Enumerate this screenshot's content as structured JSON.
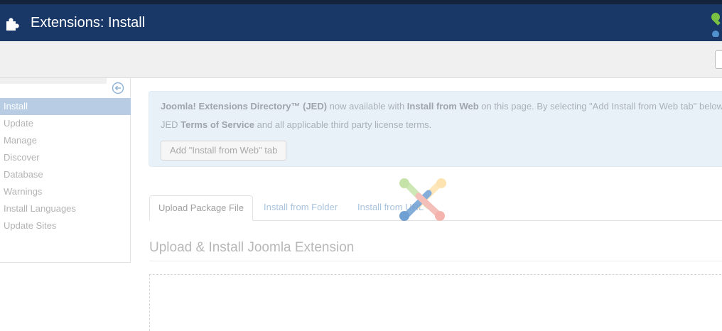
{
  "header": {
    "title": "Extensions: Install",
    "icon": "puzzle-icon",
    "bg_color": "#1a3867"
  },
  "sidebar": {
    "toggle_icon": "collapse-left-icon",
    "items": [
      {
        "label": "Install",
        "active": true
      },
      {
        "label": "Update"
      },
      {
        "label": "Manage"
      },
      {
        "label": "Discover"
      },
      {
        "label": "Database"
      },
      {
        "label": "Warnings"
      },
      {
        "label": "Install Languages"
      },
      {
        "label": "Update Sites"
      }
    ]
  },
  "notice": {
    "jed_name": "Joomla! Extensions Directory™ (JED)",
    "text1": " now available with ",
    "install_from_web": "Install from Web",
    "text2": " on this page. By selecting \"Add Install from Web tab\" below",
    "jed": "JED ",
    "terms": "Terms of Service",
    "text3": " and all applicable third party license terms.",
    "button_label": "Add \"Install from Web\" tab"
  },
  "tabs": [
    {
      "label": "Upload Package File",
      "active": true
    },
    {
      "label": "Install from Folder"
    },
    {
      "label": "Install from URL"
    }
  ],
  "section": {
    "title": "Upload & Install Joomla Extension"
  },
  "loading_icon": "joomla-logo-spinner-icon"
}
